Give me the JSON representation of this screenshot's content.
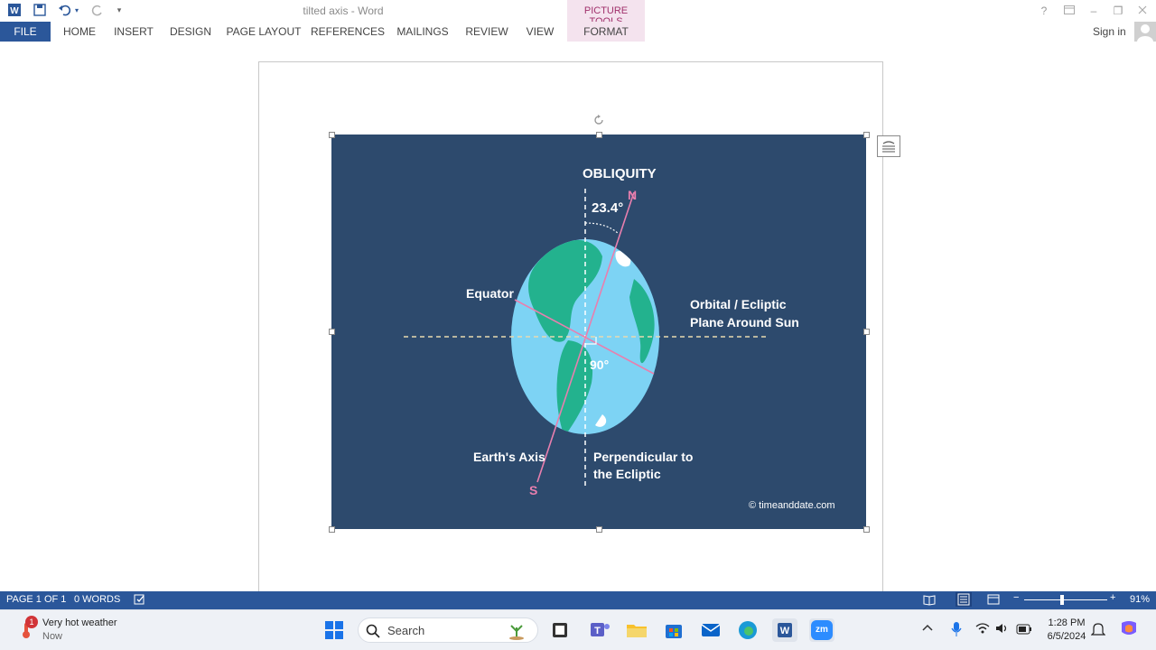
{
  "titlebar": {
    "document_title": "tilted axis - Word",
    "picture_tools": "PICTURE TOOLS",
    "help": "?",
    "minimize": "–",
    "restore": "❐",
    "qat_icons": [
      "word-icon",
      "save-icon",
      "undo-icon",
      "redo-icon",
      "customize-qat-icon"
    ]
  },
  "ribbon": {
    "tabs": [
      "FILE",
      "HOME",
      "INSERT",
      "DESIGN",
      "PAGE LAYOUT",
      "REFERENCES",
      "MAILINGS",
      "REVIEW",
      "VIEW",
      "FORMAT"
    ],
    "sign_in": "Sign in"
  },
  "figure": {
    "title": "OBLIQUITY",
    "angle_top": "23.4°",
    "north": "N",
    "south": "S",
    "equator": "Equator",
    "orbital_line1": "Orbital / Ecliptic",
    "orbital_line2": "Plane Around Sun",
    "right_angle": "90°",
    "axis": "Earth's Axis",
    "perp_line1": "Perpendicular to",
    "perp_line2": "the Ecliptic",
    "credit": "© timeanddate.com",
    "colors": {
      "background": "#2d4a6d",
      "ocean": "#7dd3f4",
      "land": "#23b28e",
      "axis_line": "#e87fae"
    }
  },
  "statusbar": {
    "page": "PAGE 1 OF 1",
    "words": "0 WORDS",
    "zoom": "91%",
    "zoom_minus": "−",
    "zoom_plus": "+"
  },
  "taskbar": {
    "weather_title": "Very hot weather",
    "weather_sub": "Now",
    "weather_badge": "1",
    "search_placeholder": "Search",
    "time": "1:28 PM",
    "date": "6/5/2024",
    "apps": [
      "start-icon",
      "files-icon",
      "teams-icon",
      "explorer-icon",
      "store-icon",
      "mail-icon",
      "edge-icon",
      "word-app-icon",
      "zoom-icon"
    ],
    "zoom_label": "zm"
  }
}
